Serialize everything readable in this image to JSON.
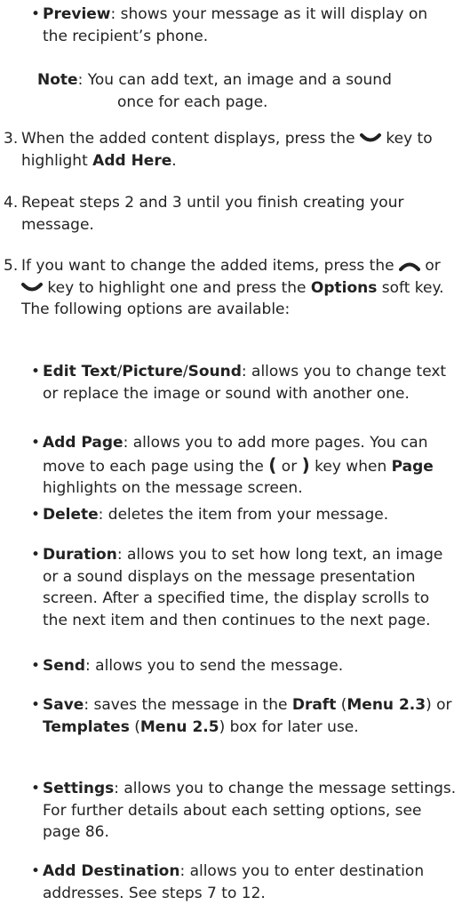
{
  "preview": {
    "term": "Preview",
    "text": ": shows your message as it will display on the recipient’s phone."
  },
  "note": {
    "term": "Note",
    "text": ": You can add text, an image and a sound once for each page."
  },
  "step3": {
    "num": "3.",
    "pre": "When the added content displays, press the",
    "mid": "key to highlight",
    "term": "Add Here",
    "post": "."
  },
  "step4": {
    "num": "4.",
    "text": "Repeat steps 2 and 3 until you finish creating your message."
  },
  "step5": {
    "num": "5.",
    "pre": "If you want to change the added items, press the",
    "or": "or",
    "mid": "key to highlight one and press the",
    "term": "Options",
    "post": "soft key. The following options are available:"
  },
  "options": [
    {
      "term1": "Edit Text",
      "sep1": "/",
      "term2": "Picture",
      "sep2": "/",
      "term3": "Sound",
      "text": ": allows you to change text or replace the image or sound with another one."
    },
    {
      "term": "Add Page",
      "pre": ": allows you to add more pages. You can move to each page using the",
      "open_key": "(",
      "or": "or",
      "close_key": ")",
      "mid": "key when",
      "term2": "Page",
      "post": "highlights on the message screen."
    },
    {
      "term": "Delete",
      "text": ": deletes the item from your message."
    },
    {
      "term": "Duration",
      "text": ": allows you to set how long text, an image or a sound displays on the message presentation screen. After a specified time, the display scrolls to the next item and then continues to the next page."
    },
    {
      "term": "Send",
      "text": ": allows you to send the message."
    },
    {
      "term": "Save",
      "t1": ": saves the message in the",
      "b1": "Draft",
      "t2": "(",
      "b2": "Menu 2.3",
      "t3": ") or",
      "b3": "Templates",
      "t4": "(",
      "b4": "Menu 2.5",
      "t5": ") box for later use."
    },
    {
      "term": "Settings",
      "text": ": allows you to change the message settings. For further details about each setting options, see page 86."
    },
    {
      "term": "Add Destination",
      "text": ": allows you to enter destination addresses. See steps 7 to 12."
    }
  ],
  "icons": {
    "down_key": "nav-down-key-icon",
    "up_key": "nav-up-key-icon"
  }
}
